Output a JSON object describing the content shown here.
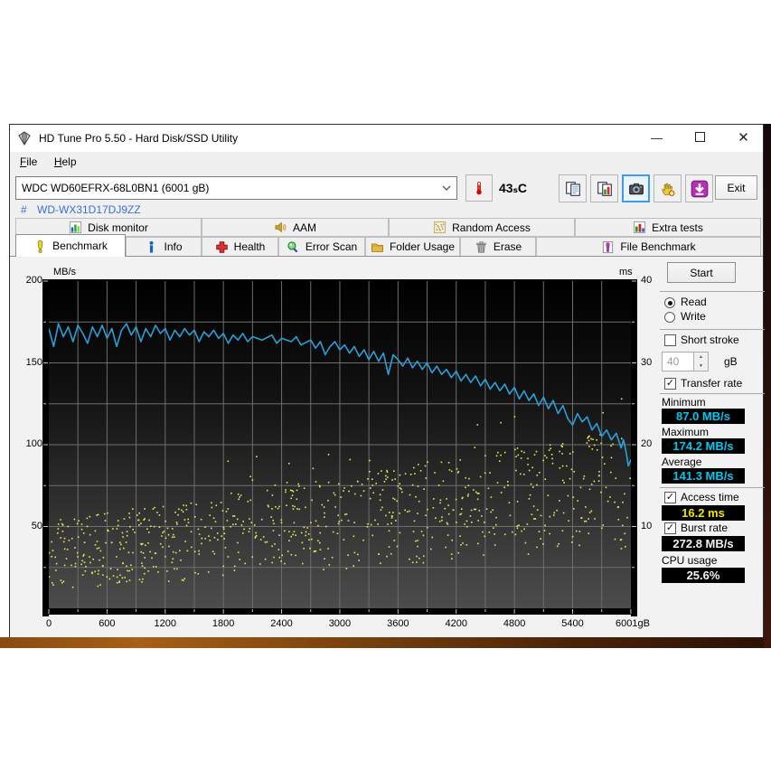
{
  "window": {
    "title": "HD Tune Pro 5.50 - Hard Disk/SSD Utility",
    "controls": {
      "minimize": "—",
      "close": "✕"
    }
  },
  "menu": {
    "items": [
      {
        "label": "File"
      },
      {
        "label": "Help"
      }
    ]
  },
  "toolbar": {
    "drive_select": "WDC WD60EFRX-68L0BN1 (6001 gB)",
    "temperature": "43ₛC",
    "exit_label": "Exit",
    "buttons": [
      {
        "icon": "copy"
      },
      {
        "icon": "copy-image"
      },
      {
        "icon": "camera"
      },
      {
        "icon": "hand"
      },
      {
        "icon": "download"
      }
    ]
  },
  "serial": {
    "hash": "#",
    "value": "WD-WX31D17DJ9ZZ"
  },
  "tabs_top": [
    {
      "label": "Disk monitor",
      "icon": "disk-monitor"
    },
    {
      "label": "AAM",
      "icon": "aam"
    },
    {
      "label": "Random Access",
      "icon": "random-access"
    },
    {
      "label": "Extra tests",
      "icon": "extra-tests"
    }
  ],
  "tabs_bottom": [
    {
      "label": "Benchmark",
      "icon": "benchmark",
      "active": true
    },
    {
      "label": "Info",
      "icon": "info"
    },
    {
      "label": "Health",
      "icon": "health"
    },
    {
      "label": "Error Scan",
      "icon": "error-scan"
    },
    {
      "label": "Folder Usage",
      "icon": "folder"
    },
    {
      "label": "Erase",
      "icon": "erase"
    },
    {
      "label": "File Benchmark",
      "icon": "file-benchmark"
    }
  ],
  "panel": {
    "start_label": "Start",
    "read_label": "Read",
    "write_label": "Write",
    "short_stroke_label": "Short stroke",
    "stroke_value": "40",
    "stroke_unit": "gB",
    "transfer_rate_label": "Transfer rate",
    "minimum_label": "Minimum",
    "minimum_value": "87.0 MB/s",
    "maximum_label": "Maximum",
    "maximum_value": "174.2 MB/s",
    "average_label": "Average",
    "average_value": "141.3 MB/s",
    "access_label": "Access time",
    "access_value": "16.2 ms",
    "burst_label": "Burst rate",
    "burst_value": "272.8 MB/s",
    "cpu_label": "CPU usage",
    "cpu_value": "25.6%"
  },
  "colors": {
    "read_line": "#29a0d8",
    "access_dots": "#eaea55",
    "grid": "#6e6e6e",
    "value_cyan": "#00c8f0",
    "value_yellow": "#f2e400",
    "value_white": "#f2f2f2"
  },
  "chart_data": {
    "type": "line",
    "title": "HD Tune benchmark read transfer rate with access time scatter",
    "x_axis": {
      "min": 0,
      "max": 6001,
      "label_step": 600,
      "grid_step": 300,
      "end_label": "6001gB"
    },
    "y_left": {
      "label": "MB/s",
      "min": 0,
      "max": 200,
      "ticks": [
        200,
        150,
        100,
        50
      ],
      "grid_step": 25
    },
    "y_right": {
      "label": "ms",
      "min": 0,
      "max": 40,
      "ticks": [
        40,
        30,
        20,
        10
      ]
    },
    "legend": "none",
    "grid": true,
    "series": [
      {
        "name": "read-transfer-rate",
        "unit": "MB/s",
        "color": "#29a0d8",
        "points": [
          [
            0,
            171
          ],
          [
            50,
            160
          ],
          [
            100,
            174
          ],
          [
            150,
            166
          ],
          [
            200,
            172
          ],
          [
            250,
            163
          ],
          [
            300,
            173
          ],
          [
            350,
            168
          ],
          [
            400,
            162
          ],
          [
            450,
            172
          ],
          [
            500,
            166
          ],
          [
            550,
            173
          ],
          [
            600,
            165
          ],
          [
            650,
            171
          ],
          [
            700,
            160
          ],
          [
            750,
            170
          ],
          [
            800,
            174
          ],
          [
            850,
            167
          ],
          [
            900,
            172
          ],
          [
            950,
            163
          ],
          [
            1000,
            171
          ],
          [
            1050,
            166
          ],
          [
            1100,
            173
          ],
          [
            1150,
            168
          ],
          [
            1200,
            171
          ],
          [
            1250,
            164
          ],
          [
            1300,
            170
          ],
          [
            1350,
            166
          ],
          [
            1400,
            171
          ],
          [
            1450,
            167
          ],
          [
            1500,
            170
          ],
          [
            1550,
            163
          ],
          [
            1600,
            169
          ],
          [
            1650,
            166
          ],
          [
            1700,
            170
          ],
          [
            1750,
            165
          ],
          [
            1800,
            168
          ],
          [
            1850,
            162
          ],
          [
            1900,
            167
          ],
          [
            1950,
            164
          ],
          [
            2000,
            168
          ],
          [
            2050,
            163
          ],
          [
            2100,
            166
          ],
          [
            2200,
            164
          ],
          [
            2300,
            167
          ],
          [
            2350,
            162
          ],
          [
            2400,
            165
          ],
          [
            2500,
            163
          ],
          [
            2550,
            166
          ],
          [
            2600,
            161
          ],
          [
            2700,
            164
          ],
          [
            2750,
            159
          ],
          [
            2800,
            163
          ],
          [
            2850,
            155
          ],
          [
            2900,
            160
          ],
          [
            2950,
            163
          ],
          [
            3000,
            158
          ],
          [
            3050,
            161
          ],
          [
            3100,
            156
          ],
          [
            3150,
            160
          ],
          [
            3200,
            154
          ],
          [
            3250,
            158
          ],
          [
            3300,
            152
          ],
          [
            3350,
            157
          ],
          [
            3400,
            151
          ],
          [
            3450,
            156
          ],
          [
            3500,
            143
          ],
          [
            3550,
            155
          ],
          [
            3600,
            152
          ],
          [
            3650,
            148
          ],
          [
            3700,
            153
          ],
          [
            3750,
            147
          ],
          [
            3800,
            151
          ],
          [
            3850,
            146
          ],
          [
            3900,
            150
          ],
          [
            3950,
            144
          ],
          [
            4000,
            148
          ],
          [
            4050,
            143
          ],
          [
            4100,
            146
          ],
          [
            4150,
            141
          ],
          [
            4200,
            145
          ],
          [
            4250,
            139
          ],
          [
            4300,
            143
          ],
          [
            4350,
            138
          ],
          [
            4400,
            142
          ],
          [
            4450,
            136
          ],
          [
            4500,
            140
          ],
          [
            4550,
            134
          ],
          [
            4600,
            138
          ],
          [
            4650,
            133
          ],
          [
            4700,
            137
          ],
          [
            4750,
            131
          ],
          [
            4800,
            135
          ],
          [
            4850,
            128
          ],
          [
            4900,
            133
          ],
          [
            4950,
            127
          ],
          [
            5000,
            131
          ],
          [
            5050,
            124
          ],
          [
            5100,
            129
          ],
          [
            5150,
            122
          ],
          [
            5200,
            127
          ],
          [
            5250,
            119
          ],
          [
            5300,
            124
          ],
          [
            5350,
            116
          ],
          [
            5400,
            112
          ],
          [
            5450,
            119
          ],
          [
            5500,
            114
          ],
          [
            5550,
            117
          ],
          [
            5600,
            109
          ],
          [
            5650,
            113
          ],
          [
            5700,
            105
          ],
          [
            5750,
            109
          ],
          [
            5800,
            103
          ],
          [
            5850,
            107
          ],
          [
            5900,
            98
          ],
          [
            5925,
            103
          ],
          [
            5950,
            96
          ],
          [
            5975,
            87
          ],
          [
            6001,
            91
          ]
        ]
      },
      {
        "name": "access-time-scatter",
        "unit": "ms",
        "type": "scatter",
        "color": "#eaea55",
        "generator": {
          "seed": 11,
          "count": 800,
          "low_base_ms": 2.2,
          "low_slope": 0.00085,
          "high_base_ms": 10.5,
          "high_slope": 0.0019,
          "bias_pow": 0.85,
          "outlier_rate": 0.03,
          "outlier_extra_ms": 4.5
        }
      }
    ],
    "summary": {
      "minimum_mbs": 87.0,
      "maximum_mbs": 174.2,
      "average_mbs": 141.3,
      "access_time_ms": 16.2,
      "burst_rate_mbs": 272.8,
      "cpu_usage_pct": 25.6
    }
  }
}
